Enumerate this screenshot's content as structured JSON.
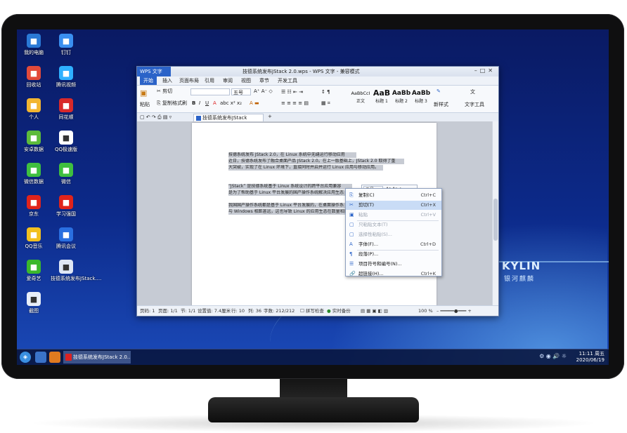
{
  "desktop_icons": [
    {
      "label": "我的电脑",
      "icon": "computer-icon",
      "color": "#2a79d6"
    },
    {
      "label": "钉钉",
      "icon": "dingtalk-icon",
      "color": "#3a8ff0"
    },
    {
      "label": "回收站",
      "icon": "trash-icon",
      "color": "#e24a3a"
    },
    {
      "label": "腾讯视频",
      "icon": "tencent-video-icon",
      "color": "#2fb0ff"
    },
    {
      "label": "个人",
      "icon": "folder-icon",
      "color": "#f2b530"
    },
    {
      "label": "同花顺",
      "icon": "tonghuashun-icon",
      "color": "#d8292a"
    },
    {
      "label": "安卓数据",
      "icon": "android-icon",
      "color": "#5dbb3a"
    },
    {
      "label": "QQ极速版",
      "icon": "qq-icon",
      "color": "#ffffff"
    },
    {
      "label": "微信数据",
      "icon": "wechat-data-icon",
      "color": "#3fbf3f"
    },
    {
      "label": "微信",
      "icon": "wechat-icon",
      "color": "#3fbf3f"
    },
    {
      "label": "京东",
      "icon": "jd-icon",
      "color": "#e0231b"
    },
    {
      "label": "学习强国",
      "icon": "xuexiqiangguo-icon",
      "color": "#e0231b"
    },
    {
      "label": "QQ音乐",
      "icon": "qq-music-icon",
      "color": "#f2c01e"
    },
    {
      "label": "腾讯会议",
      "icon": "tencent-meeting-icon",
      "color": "#2a6fe0"
    },
    {
      "label": "爱奇艺",
      "icon": "iqiyi-icon",
      "color": "#3bb82c"
    },
    {
      "label": "技德系统发布JStack....",
      "icon": "document-icon",
      "color": "#dfe7f5"
    },
    {
      "label": "截图",
      "icon": "screenshot-icon",
      "color": "#e8eef8"
    }
  ],
  "wallpaper": {
    "logo": "KYLIN",
    "logo_sub": "银河麒麟"
  },
  "taskbar": {
    "task_label": "技德系统发布JStack 2.0....",
    "clock_time": "11:11 周五",
    "clock_date": "2020/06/19"
  },
  "window": {
    "app_button": "WPS 文字",
    "title": "技德系统发布JStack 2.0.wps - WPS 文字 - 兼容模式",
    "menus": [
      "开始",
      "插入",
      "页面布局",
      "引用",
      "审阅",
      "视图",
      "章节",
      "开发工具"
    ],
    "ribbon": {
      "cut": "剪切",
      "copy": "复制",
      "paste": "粘贴",
      "format_painter": "格式刷",
      "font_size": "五号",
      "styles": [
        {
          "sample": "AaBbCcI",
          "name": "正文"
        },
        {
          "sample": "AaB",
          "name": "标题 1"
        },
        {
          "sample": "AaBb",
          "name": "标题 2"
        },
        {
          "sample": "AaBb",
          "name": "标题 3"
        }
      ],
      "new_style": "新样式",
      "text_tools": "文字工具"
    },
    "doc_tab": "技德系统发布JStack 2.0.wps",
    "document_lines": [
      "技德系统发布 JStack 2.0，在 Linux 系统中无缝运行移动应用",
      "近日，技德系统发布了融合桌面产品 JStack 2.0。在上一版基础上，JStack 2.0 取得了重",
      "大突破，实现了在 Linux 环境下，直接同时并启并运行 Linux 应用与移动应用。",
      "“JStack” 是技德系统基于 Linux 系统设计的跨平台应用兼容",
      "是为了帮助基于 Linux 平台发展的国产操作系统解决应用生态",
      "我国国产操作系统都是基于 Linux 平台发展的，在桌面操作系",
      "与 Windows 相距甚远，这也导致 Linux 的应用生态在数量和质"
    ],
    "mini_toolbar": {
      "font_size": "五号"
    },
    "status": {
      "page": "页码: 1",
      "pages": "页面: 1/1",
      "section": "节: 1/1",
      "setting": "设置值: 7.4厘米",
      "row": "行: 10",
      "col": "列: 36",
      "words": "字数: 212/212",
      "spell": "拼写检查",
      "backup": "实时备份",
      "zoom": "100 %"
    }
  },
  "context_menu": [
    {
      "label": "复制(C)",
      "key": "Ctrl+C",
      "icon": "copy-icon",
      "disabled": false,
      "highlight": false
    },
    {
      "label": "剪切(T)",
      "key": "Ctrl+X",
      "icon": "cut-icon",
      "disabled": false,
      "highlight": true
    },
    {
      "label": "粘贴",
      "key": "Ctrl+V",
      "icon": "paste-icon",
      "disabled": true,
      "highlight": false
    },
    {
      "label": "只粘贴文本(T)",
      "key": "",
      "icon": "paste-text-icon",
      "disabled": true,
      "highlight": false
    },
    {
      "label": "选择性粘贴(S)...",
      "key": "",
      "icon": "paste-special-icon",
      "disabled": true,
      "highlight": false
    },
    {
      "label": "字体(F)...",
      "key": "Ctrl+D",
      "icon": "font-icon",
      "disabled": false,
      "highlight": false
    },
    {
      "label": "段落(P)...",
      "key": "",
      "icon": "paragraph-icon",
      "disabled": false,
      "highlight": false
    },
    {
      "label": "项目符号和编号(N)...",
      "key": "",
      "icon": "bullets-icon",
      "disabled": false,
      "highlight": false
    },
    {
      "label": "超链接(H)...",
      "key": "Ctrl+K",
      "icon": "hyperlink-icon",
      "disabled": false,
      "highlight": false
    }
  ]
}
